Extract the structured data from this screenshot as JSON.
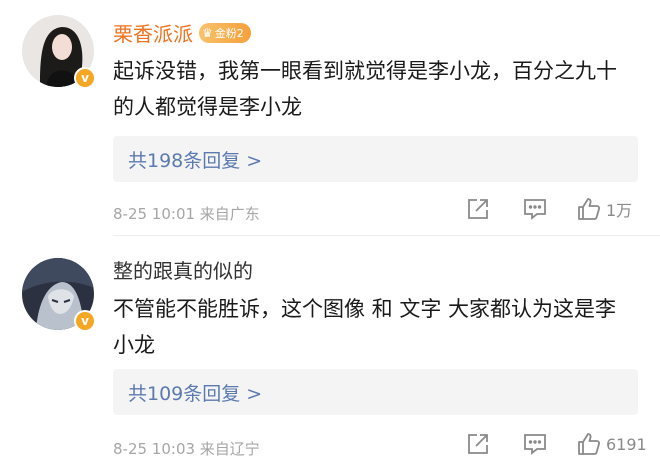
{
  "comments": [
    {
      "username": "栗香派派",
      "badge": "金粉2",
      "verified_mark": "v",
      "content": "起诉没错，我第一眼看到就觉得是李小龙，百分之九十的人都觉得是李小龙",
      "replies": "共198条回复 >",
      "meta": "8-25 10:01  来自广东",
      "likes": "1万"
    },
    {
      "username": "整的跟真的似的",
      "verified_mark": "v",
      "content": "不管能不能胜诉，这个图像 和 文字 大家都认为这是李小龙",
      "replies": "共109条回复 >",
      "meta": "8-25 10:03  来自辽宁",
      "likes": "6191"
    }
  ],
  "icons": {
    "share": "share-icon",
    "comment": "comment-icon",
    "like": "thumbs-up-icon"
  },
  "colors": {
    "username_highlight": "#f0721f",
    "link": "#5b7ab0",
    "meta": "#a6a6a6",
    "badge_gold": "#f5a623"
  }
}
